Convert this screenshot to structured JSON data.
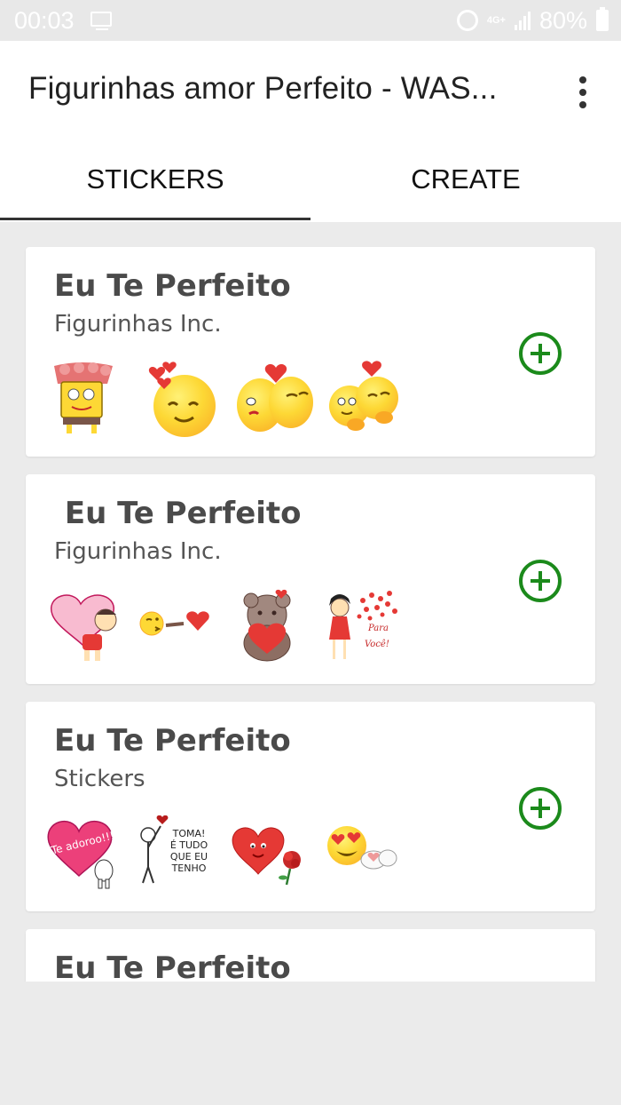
{
  "status_bar": {
    "time": "00:03",
    "network": "4G+",
    "battery": "80%"
  },
  "app_bar": {
    "title": "Figurinhas amor Perfeito - WAS..."
  },
  "tabs": [
    {
      "label": "STICKERS",
      "selected": true
    },
    {
      "label": "CREATE",
      "selected": false
    }
  ],
  "colors": {
    "accent_green": "#1b8a1b",
    "background": "#ebebeb"
  },
  "packs": [
    {
      "title": "Eu Te Perfeito",
      "publisher": "Figurinhas Inc.",
      "stickers": [
        "sponge-hearts-sticker",
        "blushing-smiley-sticker",
        "kissing-smileys-sticker",
        "hugging-smileys-sticker"
      ]
    },
    {
      "title": " Eu Te Perfeito",
      "publisher": "Figurinhas Inc.",
      "stickers": [
        "girl-holding-heart-sticker",
        "kiss-emoji-heart-sticker",
        "bear-hugging-heart-sticker",
        "girl-blowing-hearts-sticker"
      ],
      "sticker_text": {
        "para": "Para",
        "voce": "Você!"
      }
    },
    {
      "title": "Eu Te Perfeito",
      "publisher": "Stickers",
      "stickers": [
        "te-adoroo-sticker",
        "toma-tudo-sticker",
        "heart-rose-sticker",
        "heart-eyes-emoji-sticker"
      ],
      "sticker_text": {
        "te_adoroo": "Te adoroo!!!",
        "toma": "TOMA!",
        "e_tudo": "É TUDO",
        "que_eu": "QUE EU",
        "tenho": "TENHO"
      }
    },
    {
      "title": "Eu Te Perfeito"
    }
  ]
}
